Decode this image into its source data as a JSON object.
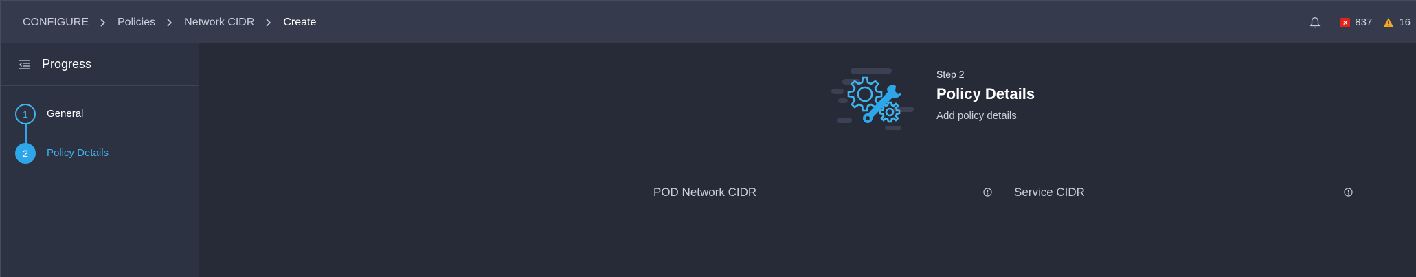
{
  "breadcrumb": {
    "items": [
      {
        "label": "CONFIGURE"
      },
      {
        "label": "Policies"
      },
      {
        "label": "Network CIDR"
      },
      {
        "label": "Create"
      }
    ]
  },
  "header": {
    "errors": {
      "icon": "x-error-icon",
      "count": "837",
      "color": "#e2231a"
    },
    "warnings": {
      "icon": "warning-icon",
      "count": "16",
      "color": "#f5a623"
    },
    "notifications_icon": "bell-icon"
  },
  "sidebar": {
    "title": "Progress",
    "steps": [
      {
        "number": "1",
        "label": "General",
        "state": "completed"
      },
      {
        "number": "2",
        "label": "Policy Details",
        "state": "active"
      }
    ],
    "accent_color": "#2ea7ea"
  },
  "main": {
    "step_number": "Step 2",
    "title": "Policy Details",
    "subtitle": "Add policy details",
    "illustration_icon": "gear-wrench-icon",
    "fields": [
      {
        "placeholder": "POD Network CIDR",
        "value": ""
      },
      {
        "placeholder": "Service CIDR",
        "value": ""
      }
    ]
  }
}
